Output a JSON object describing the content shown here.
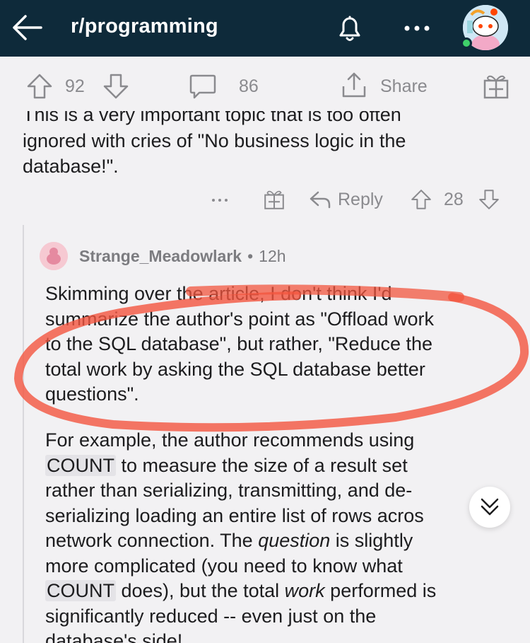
{
  "header": {
    "title": "r/programming"
  },
  "post_bar": {
    "upvotes": "92",
    "comments": "86",
    "share_label": "Share"
  },
  "parent_comment": {
    "partial_line": "This is a very important topic that is too often",
    "line2": "ignored with cries of \"No business logic in the",
    "line3": "database!\".",
    "reply_label": "Reply",
    "votes": "28"
  },
  "reply": {
    "username": "Strange_Meadowlark",
    "separator": "•",
    "time": "12h",
    "p1": [
      "Skimming over the article, I don't think I'd",
      "summarize the author's point as \"Offload work",
      "to the SQL database\", but rather, \"Reduce the",
      "total work by asking the SQL database better",
      "questions\"."
    ],
    "p2": {
      "l1": "For example, the author recommends using",
      "l2_code": "COUNT",
      "l2_rest": " to measure the size of a result set",
      "l3": "rather than serializing, transmitting, and de-",
      "l4": "serializing loading an entire list of rows acros",
      "l5": "network connection. The ",
      "l5_em": "question",
      "l5_rest": " is slightly",
      "l6": "more complicated (you need to know what",
      "l7_code": "COUNT",
      "l7_rest": " does), but the total ",
      "l7_em": "work",
      "l7_end": " performed is",
      "l8": "significantly reduced -- even just on the",
      "l9": "database's side!"
    }
  },
  "colors": {
    "header_bg": "#0e2a3a",
    "annotation": "#f2553f",
    "meta_text": "#8a8a8e"
  }
}
